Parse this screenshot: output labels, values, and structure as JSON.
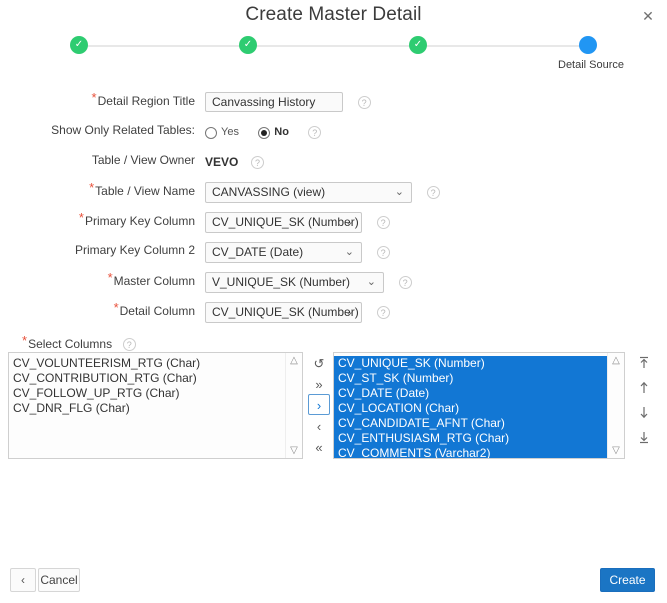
{
  "dialog": {
    "title": "Create Master Detail",
    "close_icon": "close-icon"
  },
  "wizard": {
    "steps": [
      {
        "label": "",
        "state": "done",
        "icon": "check-icon"
      },
      {
        "label": "",
        "state": "done",
        "icon": "check-icon"
      },
      {
        "label": "",
        "state": "done",
        "icon": "check-icon"
      },
      {
        "label": "Detail Source",
        "state": "current",
        "icon": "dot-icon"
      }
    ],
    "colors": {
      "done": "#2ecc71",
      "current": "#2196f3",
      "line": "#e8e8e8"
    }
  },
  "form": {
    "required_marker": "*",
    "help_icon": "help-icon",
    "fields": {
      "detail_region_title": {
        "label": "Detail Region Title",
        "value": "Canvassing History",
        "placeholder": ""
      },
      "show_only_related_tables": {
        "label": "Show Only Related Tables:",
        "options": [
          "Yes",
          "No"
        ],
        "value": "No"
      },
      "table_view_owner": {
        "label": "Table / View Owner",
        "value": "VEVO"
      },
      "table_view_name": {
        "label": "Table / View Name",
        "value": "CANVASSING (view)"
      },
      "primary_key_column": {
        "label": "Primary Key Column",
        "value": "CV_UNIQUE_SK (Number)"
      },
      "primary_key_column_2": {
        "label": "Primary Key Column 2",
        "value": "CV_DATE (Date)"
      },
      "master_column": {
        "label": "Master Column",
        "value": "V_UNIQUE_SK (Number)"
      },
      "detail_column": {
        "label": "Detail Column",
        "value": "CV_UNIQUE_SK (Number)"
      }
    }
  },
  "shuttle": {
    "label": "Select Columns",
    "available": [
      {
        "text": "CV_VOLUNTEERISM_RTG (Char)",
        "selected": false
      },
      {
        "text": "CV_CONTRIBUTION_RTG (Char)",
        "selected": false
      },
      {
        "text": "CV_FOLLOW_UP_RTG (Char)",
        "selected": false
      },
      {
        "text": "CV_DNR_FLG (Char)",
        "selected": false
      }
    ],
    "chosen": [
      {
        "text": "CV_UNIQUE_SK (Number)",
        "selected": true
      },
      {
        "text": "CV_ST_SK (Number)",
        "selected": true
      },
      {
        "text": "CV_DATE (Date)",
        "selected": true
      },
      {
        "text": "CV_LOCATION (Char)",
        "selected": true
      },
      {
        "text": "CV_CANDIDATE_AFNT (Char)",
        "selected": true
      },
      {
        "text": "CV_ENTHUSIASM_RTG (Char)",
        "selected": true
      },
      {
        "text": "CV_COMMENTS (Varchar2)",
        "selected": true
      }
    ],
    "transfer_buttons": [
      {
        "name": "reset-button",
        "glyph": "↺"
      },
      {
        "name": "move-all-right-button",
        "glyph": "»"
      },
      {
        "name": "move-right-button",
        "glyph": "›"
      },
      {
        "name": "move-left-button",
        "glyph": "‹"
      },
      {
        "name": "move-all-left-button",
        "glyph": "«"
      }
    ],
    "order_buttons": [
      {
        "name": "move-to-top-button"
      },
      {
        "name": "move-up-button"
      },
      {
        "name": "move-down-button"
      },
      {
        "name": "move-to-bottom-button"
      }
    ],
    "selection_color": "#1277d4"
  },
  "footer": {
    "back_label": "‹",
    "cancel_label": "Cancel",
    "create_label": "Create",
    "create_color": "#1b75c4"
  }
}
